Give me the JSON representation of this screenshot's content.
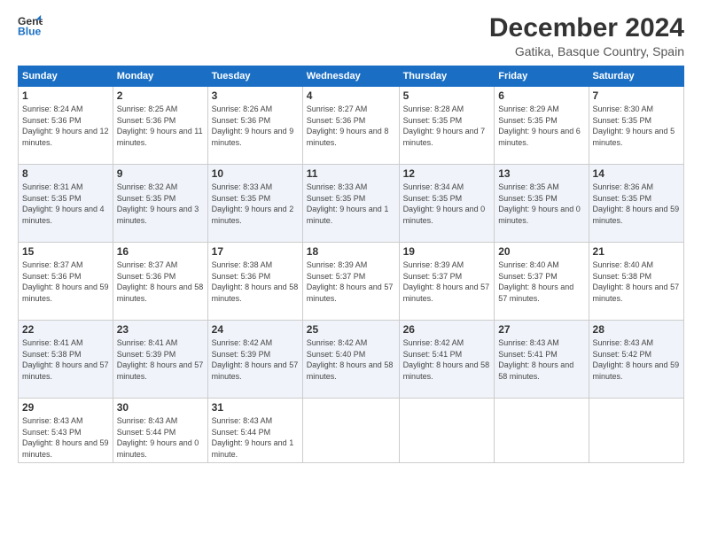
{
  "logo": {
    "line1": "General",
    "line2": "Blue"
  },
  "title": "December 2024",
  "subtitle": "Gatika, Basque Country, Spain",
  "weekdays": [
    "Sunday",
    "Monday",
    "Tuesday",
    "Wednesday",
    "Thursday",
    "Friday",
    "Saturday"
  ],
  "weeks": [
    [
      {
        "day": "1",
        "sunrise": "Sunrise: 8:24 AM",
        "sunset": "Sunset: 5:36 PM",
        "daylight": "Daylight: 9 hours and 12 minutes."
      },
      {
        "day": "2",
        "sunrise": "Sunrise: 8:25 AM",
        "sunset": "Sunset: 5:36 PM",
        "daylight": "Daylight: 9 hours and 11 minutes."
      },
      {
        "day": "3",
        "sunrise": "Sunrise: 8:26 AM",
        "sunset": "Sunset: 5:36 PM",
        "daylight": "Daylight: 9 hours and 9 minutes."
      },
      {
        "day": "4",
        "sunrise": "Sunrise: 8:27 AM",
        "sunset": "Sunset: 5:36 PM",
        "daylight": "Daylight: 9 hours and 8 minutes."
      },
      {
        "day": "5",
        "sunrise": "Sunrise: 8:28 AM",
        "sunset": "Sunset: 5:35 PM",
        "daylight": "Daylight: 9 hours and 7 minutes."
      },
      {
        "day": "6",
        "sunrise": "Sunrise: 8:29 AM",
        "sunset": "Sunset: 5:35 PM",
        "daylight": "Daylight: 9 hours and 6 minutes."
      },
      {
        "day": "7",
        "sunrise": "Sunrise: 8:30 AM",
        "sunset": "Sunset: 5:35 PM",
        "daylight": "Daylight: 9 hours and 5 minutes."
      }
    ],
    [
      {
        "day": "8",
        "sunrise": "Sunrise: 8:31 AM",
        "sunset": "Sunset: 5:35 PM",
        "daylight": "Daylight: 9 hours and 4 minutes."
      },
      {
        "day": "9",
        "sunrise": "Sunrise: 8:32 AM",
        "sunset": "Sunset: 5:35 PM",
        "daylight": "Daylight: 9 hours and 3 minutes."
      },
      {
        "day": "10",
        "sunrise": "Sunrise: 8:33 AM",
        "sunset": "Sunset: 5:35 PM",
        "daylight": "Daylight: 9 hours and 2 minutes."
      },
      {
        "day": "11",
        "sunrise": "Sunrise: 8:33 AM",
        "sunset": "Sunset: 5:35 PM",
        "daylight": "Daylight: 9 hours and 1 minute."
      },
      {
        "day": "12",
        "sunrise": "Sunrise: 8:34 AM",
        "sunset": "Sunset: 5:35 PM",
        "daylight": "Daylight: 9 hours and 0 minutes."
      },
      {
        "day": "13",
        "sunrise": "Sunrise: 8:35 AM",
        "sunset": "Sunset: 5:35 PM",
        "daylight": "Daylight: 9 hours and 0 minutes."
      },
      {
        "day": "14",
        "sunrise": "Sunrise: 8:36 AM",
        "sunset": "Sunset: 5:35 PM",
        "daylight": "Daylight: 8 hours and 59 minutes."
      }
    ],
    [
      {
        "day": "15",
        "sunrise": "Sunrise: 8:37 AM",
        "sunset": "Sunset: 5:36 PM",
        "daylight": "Daylight: 8 hours and 59 minutes."
      },
      {
        "day": "16",
        "sunrise": "Sunrise: 8:37 AM",
        "sunset": "Sunset: 5:36 PM",
        "daylight": "Daylight: 8 hours and 58 minutes."
      },
      {
        "day": "17",
        "sunrise": "Sunrise: 8:38 AM",
        "sunset": "Sunset: 5:36 PM",
        "daylight": "Daylight: 8 hours and 58 minutes."
      },
      {
        "day": "18",
        "sunrise": "Sunrise: 8:39 AM",
        "sunset": "Sunset: 5:37 PM",
        "daylight": "Daylight: 8 hours and 57 minutes."
      },
      {
        "day": "19",
        "sunrise": "Sunrise: 8:39 AM",
        "sunset": "Sunset: 5:37 PM",
        "daylight": "Daylight: 8 hours and 57 minutes."
      },
      {
        "day": "20",
        "sunrise": "Sunrise: 8:40 AM",
        "sunset": "Sunset: 5:37 PM",
        "daylight": "Daylight: 8 hours and 57 minutes."
      },
      {
        "day": "21",
        "sunrise": "Sunrise: 8:40 AM",
        "sunset": "Sunset: 5:38 PM",
        "daylight": "Daylight: 8 hours and 57 minutes."
      }
    ],
    [
      {
        "day": "22",
        "sunrise": "Sunrise: 8:41 AM",
        "sunset": "Sunset: 5:38 PM",
        "daylight": "Daylight: 8 hours and 57 minutes."
      },
      {
        "day": "23",
        "sunrise": "Sunrise: 8:41 AM",
        "sunset": "Sunset: 5:39 PM",
        "daylight": "Daylight: 8 hours and 57 minutes."
      },
      {
        "day": "24",
        "sunrise": "Sunrise: 8:42 AM",
        "sunset": "Sunset: 5:39 PM",
        "daylight": "Daylight: 8 hours and 57 minutes."
      },
      {
        "day": "25",
        "sunrise": "Sunrise: 8:42 AM",
        "sunset": "Sunset: 5:40 PM",
        "daylight": "Daylight: 8 hours and 58 minutes."
      },
      {
        "day": "26",
        "sunrise": "Sunrise: 8:42 AM",
        "sunset": "Sunset: 5:41 PM",
        "daylight": "Daylight: 8 hours and 58 minutes."
      },
      {
        "day": "27",
        "sunrise": "Sunrise: 8:43 AM",
        "sunset": "Sunset: 5:41 PM",
        "daylight": "Daylight: 8 hours and 58 minutes."
      },
      {
        "day": "28",
        "sunrise": "Sunrise: 8:43 AM",
        "sunset": "Sunset: 5:42 PM",
        "daylight": "Daylight: 8 hours and 59 minutes."
      }
    ],
    [
      {
        "day": "29",
        "sunrise": "Sunrise: 8:43 AM",
        "sunset": "Sunset: 5:43 PM",
        "daylight": "Daylight: 8 hours and 59 minutes."
      },
      {
        "day": "30",
        "sunrise": "Sunrise: 8:43 AM",
        "sunset": "Sunset: 5:44 PM",
        "daylight": "Daylight: 9 hours and 0 minutes."
      },
      {
        "day": "31",
        "sunrise": "Sunrise: 8:43 AM",
        "sunset": "Sunset: 5:44 PM",
        "daylight": "Daylight: 9 hours and 1 minute."
      },
      null,
      null,
      null,
      null
    ]
  ]
}
